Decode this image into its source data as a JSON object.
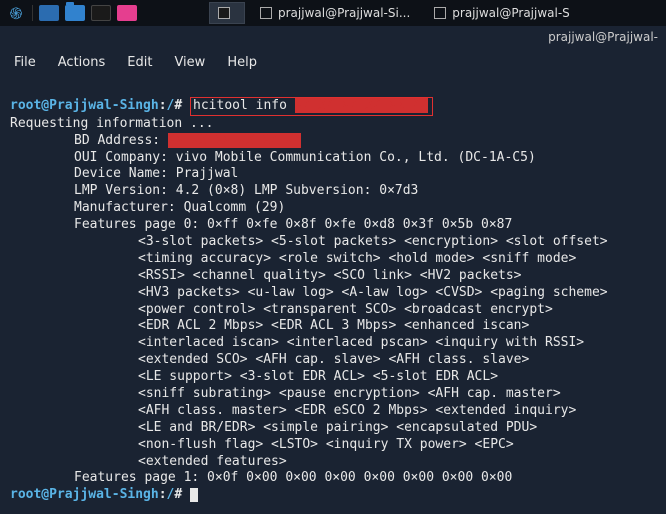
{
  "taskbar": {
    "windows": [
      {
        "label": "",
        "active": true
      },
      {
        "label": "prajjwal@Prajjwal-Si...",
        "active": false
      },
      {
        "label": "prajjwal@Prajjwal-S",
        "active": false
      }
    ]
  },
  "titlebar": {
    "text": "prajjwal@Prajjwal-"
  },
  "menubar": {
    "file": "File",
    "actions": "Actions",
    "edit": "Edit",
    "view": "View",
    "help": "Help"
  },
  "prompt": {
    "user": "root@Prajjwal-Singh",
    "sep": ":",
    "path": "/",
    "hash": "#"
  },
  "command": {
    "cmd": "hcitool info",
    "arg_redacted": "XX:XX:XX:XX:XX:XX"
  },
  "output": {
    "requesting": "Requesting information ...",
    "bd_label": "BD Address:",
    "bd_redacted": "XX:XX:XX:XX:XX:XX",
    "oui": "OUI Company: vivo Mobile Communication Co., Ltd. (DC-1A-C5)",
    "device": "Device Name: Prajjwal",
    "lmp": "LMP Version: 4.2 (0×8) LMP Subversion: 0×7d3",
    "manu": "Manufacturer: Qualcomm (29)",
    "feat0": "Features page 0: 0×ff 0×fe 0×8f 0×fe 0×d8 0×3f 0×5b 0×87",
    "f1": "<3-slot packets> <5-slot packets> <encryption> <slot offset>",
    "f2": "<timing accuracy> <role switch> <hold mode> <sniff mode>",
    "f3": "<RSSI> <channel quality> <SCO link> <HV2 packets>",
    "f4": "<HV3 packets> <u-law log> <A-law log> <CVSD> <paging scheme>",
    "f5": "<power control> <transparent SCO> <broadcast encrypt>",
    "f6": "<EDR ACL 2 Mbps> <EDR ACL 3 Mbps> <enhanced iscan>",
    "f7": "<interlaced iscan> <interlaced pscan> <inquiry with RSSI>",
    "f8": "<extended SCO> <AFH cap. slave> <AFH class. slave>",
    "f9": "<LE support> <3-slot EDR ACL> <5-slot EDR ACL>",
    "f10": "<sniff subrating> <pause encryption> <AFH cap. master>",
    "f11": "<AFH class. master> <EDR eSCO 2 Mbps> <extended inquiry>",
    "f12": "<LE and BR/EDR> <simple pairing> <encapsulated PDU>",
    "f13": "<non-flush flag> <LSTO> <inquiry TX power> <EPC>",
    "f14": "<extended features>",
    "feat1": "Features page 1: 0×0f 0×00 0×00 0×00 0×00 0×00 0×00 0×00"
  }
}
